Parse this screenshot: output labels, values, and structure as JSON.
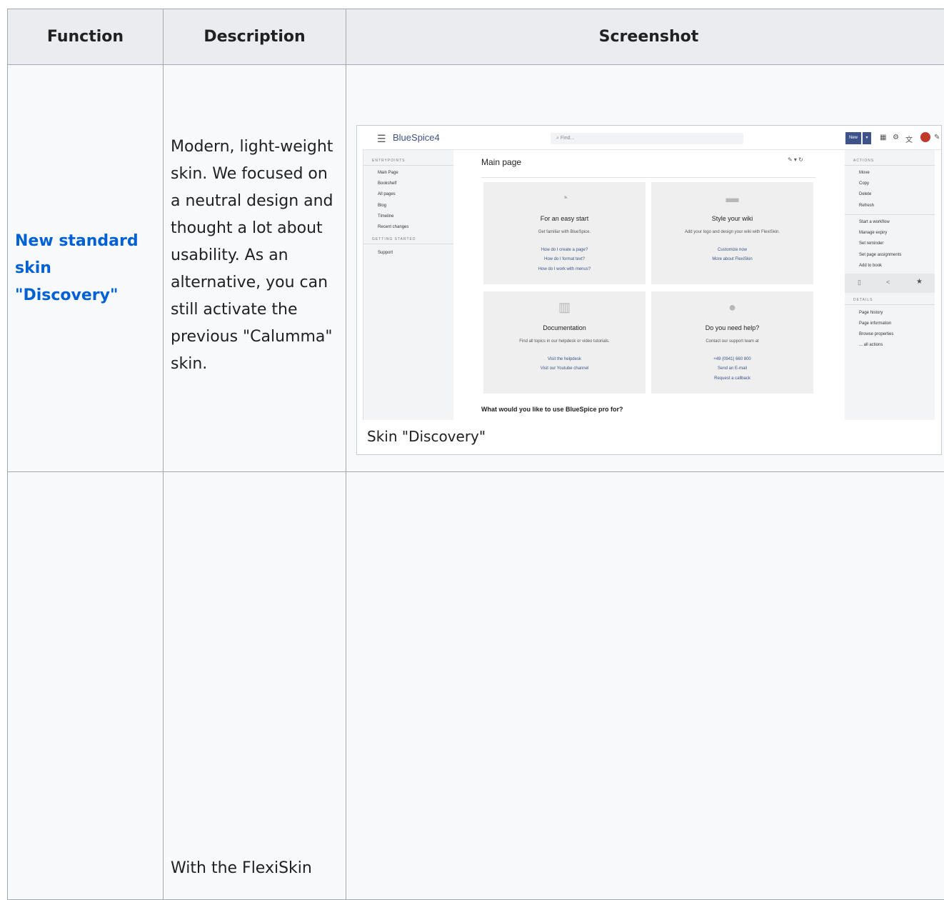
{
  "table": {
    "headers": {
      "function": "Function",
      "description": "Description",
      "screenshot": "Screenshot"
    },
    "row1": {
      "function_link": "New standard skin \"Discovery\"",
      "description": "Modern, light-weight skin. We focused on a neutral design and thought a lot about usability. As an alternative, you can still activate the previous \"Calumma\" skin.",
      "caption": "Skin \"Discovery\""
    },
    "row2": {
      "description": "With the FlexiSkin"
    }
  },
  "mini": {
    "logo": "BlueSpice",
    "logo_suffix": "4",
    "search_placeholder": "Find...",
    "new_label": "New",
    "left": {
      "sec1": "ENTRYPOINTS",
      "items1": [
        "Main Page",
        "Bookshelf",
        "All pages",
        "Blog",
        "Timeline",
        "Recent changes"
      ],
      "sec2": "GETTING STARTED",
      "items2": [
        "Support"
      ]
    },
    "right": {
      "sec1": "ACTIONS",
      "items1": [
        "Move",
        "Copy",
        "Delete",
        "Refresh"
      ],
      "items2": [
        "Start a workflow",
        "Manage expiry",
        "Set reminder",
        "Set page assignments",
        "Add to book"
      ],
      "sec2": "DETAILS",
      "items3": [
        "Page history",
        "Page information",
        "Browse properties",
        "... all actions"
      ]
    },
    "page_title": "Main page",
    "cards": [
      {
        "title": "For an easy start",
        "sub": "Get familiar with BlueSpice.",
        "links": [
          "How do I create a page?",
          "How do I format text?",
          "How do I work with menus?"
        ]
      },
      {
        "title": "Style your wiki",
        "sub": "Add your logo and design your wiki with FlexiSkin.",
        "links": [
          "Customize now",
          "More about FlexiSkin"
        ]
      },
      {
        "title": "Documentation",
        "sub": "Find all topics in our helpdesk or video tutorials.",
        "links": [
          "Visit the helpdesk",
          "Visit our Youtube channel"
        ]
      },
      {
        "title": "Do you need help?",
        "sub": "Contact our support team at",
        "links": [
          "+49 (0941) 660 800",
          "Send an E-mail",
          "Request a callback"
        ]
      }
    ],
    "question": "What would you like to use BlueSpice pro for?"
  },
  "icons": {
    "burger": "menu-icon",
    "grid": "apps-grid-icon",
    "gear": "gear-icon",
    "translate": "translate-icon",
    "edit": "pencil-icon"
  }
}
